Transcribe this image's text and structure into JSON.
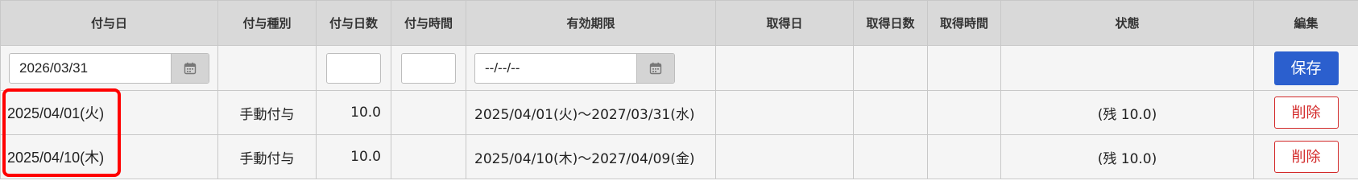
{
  "headers": {
    "grant_date": "付与日",
    "grant_type": "付与種別",
    "grant_days": "付与日数",
    "grant_hours": "付与時間",
    "expiry": "有効期限",
    "acquired_date": "取得日",
    "acquired_days": "取得日数",
    "acquired_hours": "取得時間",
    "status": "状態",
    "edit": "編集"
  },
  "input_row": {
    "grant_date_value": "2026/03/31",
    "grant_days_value": "",
    "grant_hours_value": "",
    "expiry_value": "--/--/--",
    "save_label": "保存"
  },
  "rows": [
    {
      "grant_date": "2025/04/01(火)",
      "grant_type": "手動付与",
      "grant_days": "10.0",
      "grant_hours": "",
      "expiry": "2025/04/01(火)～2027/03/31(水)",
      "acquired_date": "",
      "acquired_days": "",
      "acquired_hours": "",
      "status": "(残 10.0)",
      "delete_label": "削除"
    },
    {
      "grant_date": "2025/04/10(木)",
      "grant_type": "手動付与",
      "grant_days": "10.0",
      "grant_hours": "",
      "expiry": "2025/04/10(木)～2027/04/09(金)",
      "acquired_date": "",
      "acquired_days": "",
      "acquired_hours": "",
      "status": "(残 10.0)",
      "delete_label": "削除"
    }
  ],
  "icons": {
    "calendar": "calendar-icon"
  },
  "colors": {
    "save_button": "#2b5fce",
    "delete_button": "#d32a2a",
    "highlight": "#ff0000",
    "header_bg": "#d9d9d9"
  }
}
